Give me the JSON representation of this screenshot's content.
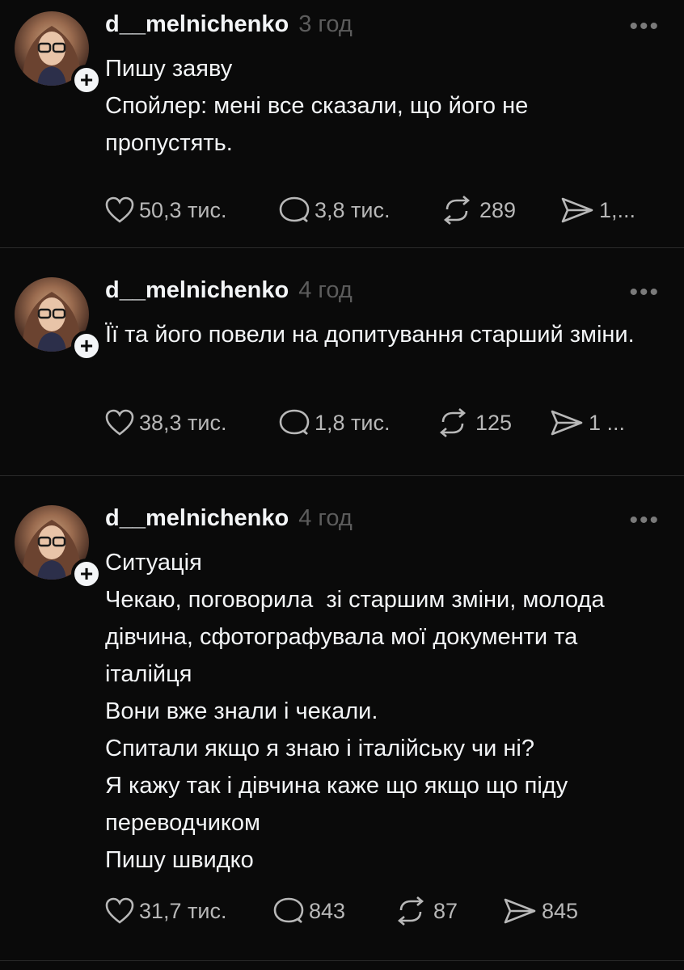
{
  "posts": [
    {
      "username": "d__melnichenko",
      "time": "3 год",
      "text": "Пишу заяву\nСпойлер: мені все сказали, що його не пропустять.",
      "likes": "50,3 тис.",
      "comments": "3,8 тис.",
      "reposts": "289",
      "shares": "1,..."
    },
    {
      "username": "d__melnichenko",
      "time": "4 год",
      "text": "Її та його повели на допитування старший зміни.",
      "likes": "38,3 тис.",
      "comments": "1,8 тис.",
      "reposts": "125",
      "shares": "1 ..."
    },
    {
      "username": "d__melnichenko",
      "time": "4 год",
      "text": "Ситуація\nЧекаю, поговорила  зі старшим зміни, молода дівчина, сфотографувала мої документи та італійця\nВони вже знали і чекали.\nСпитали якщо я знаю і італійську чи ні?\nЯ кажу так і дівчина каже що якщо що піду переводчиком\nПишу швидко",
      "likes": "31,7 тис.",
      "comments": "843",
      "reposts": "87",
      "shares": "845"
    }
  ],
  "icons": {
    "more": "more-options-icon",
    "like": "heart-icon",
    "comment": "comment-bubble-icon",
    "repost": "repost-arrows-icon",
    "share": "send-icon",
    "follow": "plus-icon"
  },
  "colors": {
    "background": "#0a0a0a",
    "text": "#f3f5f7",
    "muted": "#5c5c5c",
    "divider": "#2a2a2a"
  }
}
